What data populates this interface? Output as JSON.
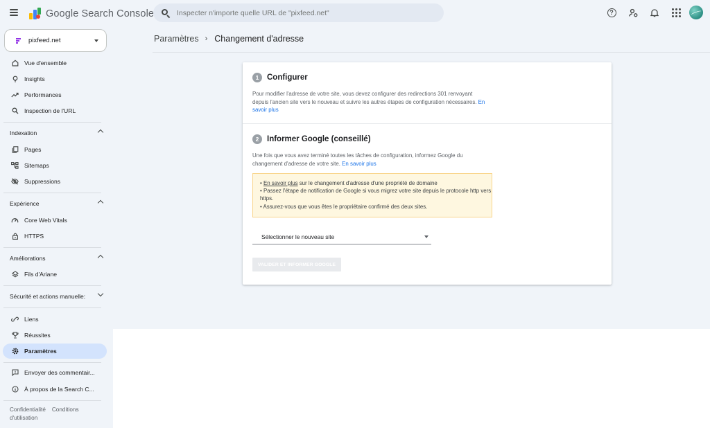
{
  "app": {
    "title": "Google Search Console"
  },
  "search": {
    "placeholder": "Inspecter n'importe quelle URL de \"pixfeed.net\""
  },
  "top_icons": [
    "help-icon",
    "admin-icon",
    "bell-icon",
    "apps-icon",
    "avatar"
  ],
  "property": {
    "name": "pixfeed.net"
  },
  "sidebar": {
    "top_items": [
      {
        "label": "Vue d'ensemble",
        "icon": "home-icon"
      },
      {
        "label": "Insights",
        "icon": "lightbulb-icon"
      },
      {
        "label": "Performances",
        "icon": "trending-icon"
      },
      {
        "label": "Inspection de l'URL",
        "icon": "search-icon"
      }
    ],
    "sections": {
      "indexation": {
        "title": "Indexation",
        "items": [
          {
            "label": "Pages",
            "icon": "pages-icon"
          },
          {
            "label": "Sitemaps",
            "icon": "sitemap-icon"
          },
          {
            "label": "Suppressions",
            "icon": "visibility-off-icon"
          }
        ]
      },
      "experience": {
        "title": "Expérience",
        "items": [
          {
            "label": "Core Web Vitals",
            "icon": "speed-icon"
          },
          {
            "label": "HTTPS",
            "icon": "lock-icon"
          }
        ]
      },
      "ameliorations": {
        "title": "Améliorations",
        "items": [
          {
            "label": "Fils d'Ariane",
            "icon": "layers-icon"
          }
        ]
      },
      "securite": {
        "title": "Sécurité et actions manuelle:"
      }
    },
    "bottom_items": [
      {
        "label": "Liens",
        "icon": "link-icon"
      },
      {
        "label": "Réussites",
        "icon": "trophy-icon"
      },
      {
        "label": "Paramètres",
        "icon": "settings-icon",
        "active": true
      }
    ],
    "extra_items": [
      {
        "label": "Envoyer des commentair...",
        "icon": "feedback-icon"
      },
      {
        "label": "À propos de la Search C...",
        "icon": "info-icon"
      }
    ],
    "footer": {
      "privacy": "Confidentialité",
      "terms": "Conditions d'utilisation"
    }
  },
  "breadcrumb": {
    "parent": "Paramètres",
    "separator": "›",
    "current": "Changement d'adresse"
  },
  "steps": {
    "configure": {
      "number": "1",
      "title": "Configurer",
      "text": "Pour modifier l'adresse de votre site, vous devez configurer des redirections 301 renvoyant depuis l'ancien site vers le nouveau et suivre les autres étapes de configuration nécessaires.",
      "link": "En savoir plus"
    },
    "inform": {
      "number": "2",
      "title": "Informer Google (conseillé)",
      "text": "Une fois que vous avez terminé toutes les tâches de configuration, informez Google du changement d'adresse de votre site.",
      "link": "En savoir plus"
    }
  },
  "notice": {
    "line1_link": "En savoir plus",
    "line1_rest": " sur le changement d'adresse d'une propriété de domaine",
    "line2": "• Passez l'étape de notification de Google si vous migrez votre site depuis le protocole http vers https.",
    "line3": "• Assurez-vous que vous êtes le propriétaire confirmé des deux sites."
  },
  "select": {
    "label": "Sélectionner le nouveau site"
  },
  "validate_button": {
    "label": "VALIDER ET INFORMER GOOGLE"
  },
  "colors": {
    "accent": "#1a73e8",
    "active_nav": "#d3e3fd",
    "shell_bg": "#f0f4f9",
    "notice_bg": "#fef7e0"
  }
}
